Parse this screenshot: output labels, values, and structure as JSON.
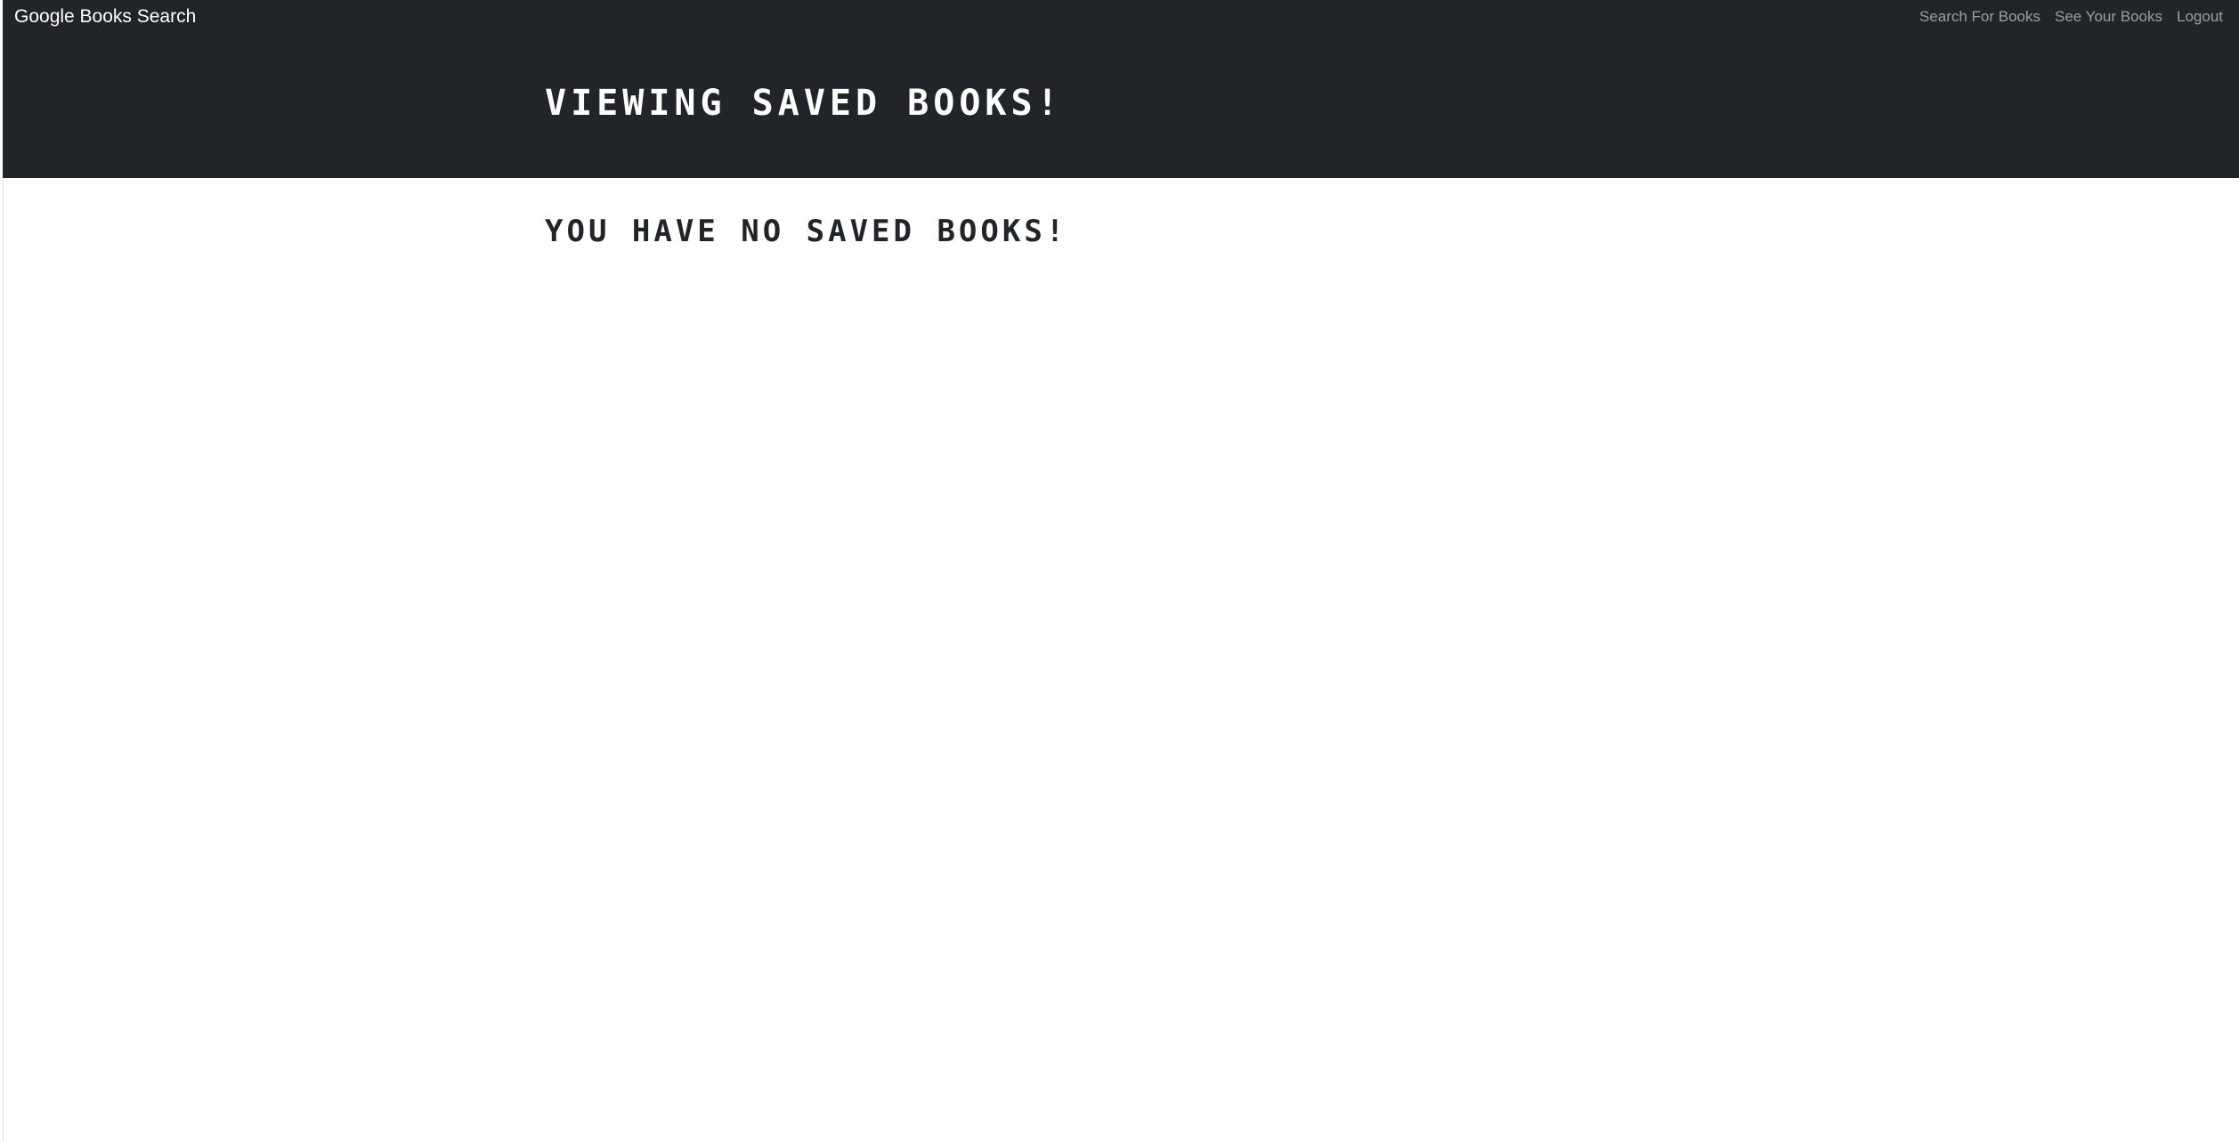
{
  "navbar": {
    "brand": "Google Books Search",
    "links": [
      {
        "label": "Search For Books"
      },
      {
        "label": "See Your Books"
      },
      {
        "label": "Logout"
      }
    ]
  },
  "hero": {
    "title": "Viewing saved books!"
  },
  "main": {
    "empty_message": "You have no saved books!"
  },
  "colors": {
    "navbar_bg": "#212529",
    "hero_bg": "#212529",
    "page_bg": "#ffffff",
    "heading_dark": "#212529",
    "nav_link": "rgba(255,255,255,0.55)"
  }
}
